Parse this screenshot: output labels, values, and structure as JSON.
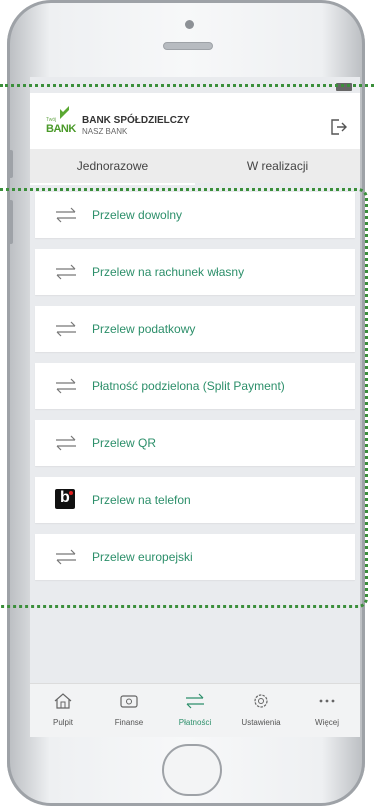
{
  "bank": {
    "logo_small": "Twój",
    "logo_big": "BANK",
    "name": "BANK SPÓŁDZIELCZY",
    "subtitle": "NASZ BANK"
  },
  "tabs": [
    {
      "label": "Jednorazowe",
      "active": true
    },
    {
      "label": "W realizacji",
      "active": false
    }
  ],
  "transfers": [
    {
      "label": "Przelew dowolny",
      "icon": "transfer-arrows-icon"
    },
    {
      "label": "Przelew na rachunek własny",
      "icon": "transfer-arrows-icon"
    },
    {
      "label": "Przelew podatkowy",
      "icon": "transfer-arrows-icon"
    },
    {
      "label": "Płatność podzielona (Split Payment)",
      "icon": "transfer-arrows-icon"
    },
    {
      "label": "Przelew QR",
      "icon": "transfer-arrows-icon"
    },
    {
      "label": "Przelew na telefon",
      "icon": "blik-icon"
    },
    {
      "label": "Przelew europejski",
      "icon": "transfer-arrows-icon"
    }
  ],
  "nav": [
    {
      "label": "Pulpit",
      "icon": "home-icon",
      "active": false
    },
    {
      "label": "Finanse",
      "icon": "wallet-icon",
      "active": false
    },
    {
      "label": "Płatności",
      "icon": "transfer-arrows-icon",
      "active": true
    },
    {
      "label": "Ustawienia",
      "icon": "gear-icon",
      "active": false
    },
    {
      "label": "Więcej",
      "icon": "more-dots-icon",
      "active": false
    }
  ],
  "colors": {
    "accent": "#2c8f6a",
    "logo_green": "#4b9a2a",
    "highlight_dots": "#3b8f3b"
  }
}
